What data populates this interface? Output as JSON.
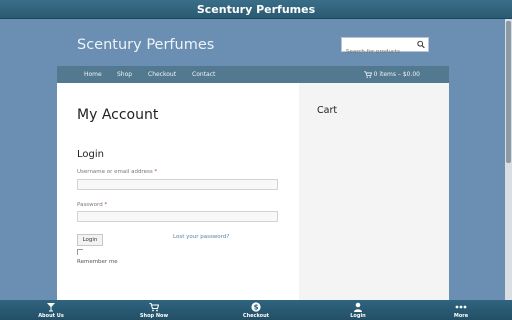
{
  "app_title": "Scentury Perfumes",
  "site": {
    "title": "Scentury Perfumes"
  },
  "search": {
    "placeholder": "Search for products"
  },
  "nav": {
    "items": [
      {
        "label": "Home"
      },
      {
        "label": "Shop"
      },
      {
        "label": "Checkout"
      },
      {
        "label": "Contact"
      }
    ],
    "cart_summary": "0 items – $0.00"
  },
  "main": {
    "page_title": "My Account",
    "login_heading": "Login",
    "username_label": "Username or email address",
    "password_label": "Password",
    "required_marker": "*",
    "login_button": "Login",
    "lost_password": "Lost your password?",
    "remember_me": "Remember me"
  },
  "sidebar": {
    "title": "Cart"
  },
  "bottom_tabs": [
    {
      "label": "About Us",
      "icon": "cocktail-icon"
    },
    {
      "label": "Shop Now",
      "icon": "cart-icon"
    },
    {
      "label": "Checkout",
      "icon": "dollar-icon"
    },
    {
      "label": "Login",
      "icon": "user-icon"
    },
    {
      "label": "More",
      "icon": "more-dots-icon"
    }
  ],
  "colors": {
    "background": "#6a8fb3",
    "topbar": "#2b5a72",
    "navbar": "#52798f",
    "link": "#5b82a6",
    "required": "#c0392b"
  }
}
